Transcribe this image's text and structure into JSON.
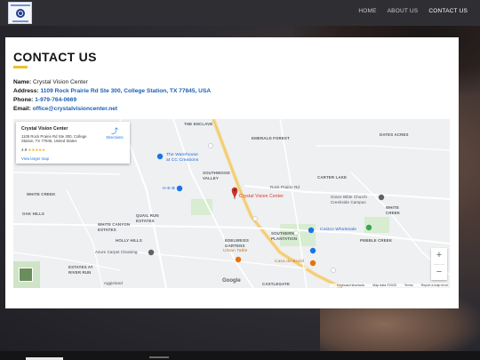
{
  "nav": {
    "items": [
      "HOME",
      "ABOUT US",
      "CONTACT US"
    ],
    "active_index": 2
  },
  "contact": {
    "title": "CONTACT US",
    "name_label": "Name:",
    "name_value": "Crystal Vision Center",
    "address_label": "Address:",
    "address_value": "1109 Rock Prairie Rd Ste 300, College Station, TX 77845, USA",
    "phone_label": "Phone:",
    "phone_value": "1-979-764-0669",
    "email_label": "Email:",
    "email_value": "office@crystalvisioncenter.net"
  },
  "map": {
    "place_card": {
      "name": "Crystal Vision Center",
      "address": "1109 Rock Prairie Rd Ste 300, College Station, TX 77845, United States",
      "rating": "4.9",
      "stars": "★★★★★",
      "directions": "Directions",
      "larger_map": "View larger map"
    },
    "pin_label": "Crystal Vision Center",
    "labels": {
      "the_enclave": "THE ENCLAVE",
      "emerald_forest": "EMERALD FOREST",
      "dates_acres": "DATES ACRES",
      "the_warehouse": "The Warehouse",
      "at_cc_creations": "at CC Creations",
      "southwood": "SOUTHWOOD",
      "valley": "VALLEY",
      "carter_lake": "CARTER LAKE",
      "heb_1": "H-E-B",
      "heb_2": "H-E-B",
      "white_creek": "WHITE CREEK",
      "grace_bible_1": "Grace Bible Church",
      "grace_bible_2": "Creekside Campus",
      "white_creek_2": "WHITE",
      "creek_2": "CREEK",
      "oak_hills": "OAK HILLS",
      "quail_run_1": "QUAIL RUN",
      "quail_run_2": "ESTATES",
      "costco": "Costco Wholesale",
      "white_canyon_1": "WHITE CANYON",
      "white_canyon_2": "ESTATES",
      "pebble_creek": "PEBBLE CREEK",
      "holly_hills": "HOLLY HILLS",
      "edelweiss_1": "EDELWEISS",
      "edelweiss_2": "GARTENS",
      "southern_1": "SOUTHERN",
      "southern_2": "PLANTATION",
      "azure": "Azure Carpet Cleaning",
      "urban_table": "Urban Table",
      "casa": "Casa do Brasil",
      "estates_1": "ESTATES AT",
      "estates_2": "RIVER RUN",
      "aggieland": "Aggieland",
      "castlegate": "CASTLEGATE",
      "rock_prairie": "Rock Prairie Rd",
      "shortcuts": "Keyboard shortcuts",
      "map_data": "Map data ©2025",
      "terms": "Terms",
      "report": "Report a map error",
      "google": "Google"
    }
  },
  "colors": {
    "accent": "#e7c42c",
    "link": "#1a5fb4",
    "topbar": "#2f2f33",
    "pin": "#d93025"
  }
}
